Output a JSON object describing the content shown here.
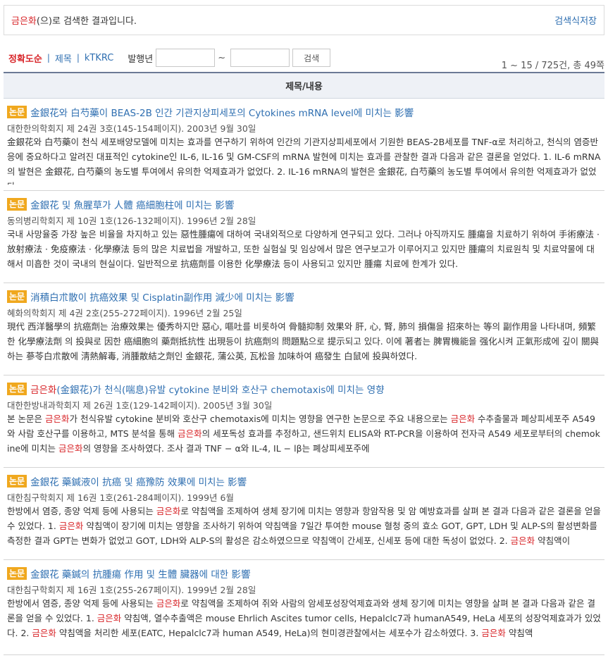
{
  "banner": {
    "keyword": "금은화",
    "message_suffix": "(으)로 검색한 결과입니다.",
    "save_label": "검색식저장"
  },
  "filters": {
    "sort_options": [
      "정확도순",
      "제목",
      "kTKRC"
    ],
    "active_sort": "정확도순",
    "year_label": "발행년",
    "year_from": "",
    "year_to": "",
    "tilde": "~",
    "search_button": "검색"
  },
  "result_count": "1 ~ 15 / 725건, 총 49쪽",
  "table_header": "제목/내용",
  "badge_label": "논문",
  "results": [
    {
      "title": "金銀花와 白芍藥이 BEAS-2B 인간 기관지상피세포의 Cytokines mRNA level에 미치는 影響",
      "source": "대한한의학회지 제 24권 3호(145-154페이지). 2003년 9월 30일",
      "abstract": "金銀花와 白芍藥이 천식 세포배양모델에 미치는 효과를 연구하기 위하여 인간의 기관지상피세포에서 기원한 BEAS-2B세포를 TNF-α로 처리하고, 천식의 염증반응에 중요하다고 알려진 대표적인 cytokine인 IL-6, IL-16 및 GM-CSF의 mRNA 발현에 미치는 효과를 관찰한 결과 다음과 같은 결론을 얻었다. 1. IL-6 mRNA의 발현은 金銀花, 白芍藥의 농도별 투여에서 유의한 억제효과가 없었다. 2. IL-16 mRNA의 발현은 金銀花, 白芍藥의 농도별 투여에서 유의한 억제효과가 없었다."
    },
    {
      "title": "金銀花 및 魚腥草가 人體 癌細胞柱에 미치는 影響",
      "source": "동의병리학회지 제 10권 1호(126-132페이지). 1996년 2월 28일",
      "abstract": "국내 사망율중 가장 높은 비율을 차지하고 있는 惡性腫瘍에 대하여 국내외적으로 다양하게 연구되고 있다. 그러나 아직까지도 腫瘍을 치료하기 위하여 手術療法 · 放射療法 · 免疫療法 · 化學療法 등의 많은 치료법을 개발하고, 또한 실험실 및 임상에서 많은 연구보고가 이루어지고 있지만 腫瘍의 치료원칙 및 치료약물에 대해서 미흡한 것이 국내의 현실이다. 일반적으로 抗癌劑를 이용한 化學療法 등이 사용되고 있지만 腫瘍 치료에 한계가 있다."
    },
    {
      "title": "消積白朮散이 抗癌效果 및 Cisplatin副作用 減少에 미치는 影響",
      "source": "혜화의학회지 제 4권 2호(255-272페이지). 1996년 2월 25일",
      "abstract": "現代 西洋醫學의 抗癌劑는 治療效果는 優秀하지만 惡心, 嘔吐를 비롯하여 骨髓抑制 效果와 肝, 心, 腎, 肺의 損傷을 招來하는 等의 副作用을 나타내며, 頻繁한 化學療法劑 의 投與로 因한 癌細胞의 藥劑抵抗性 出現등이 抗癌劑의 問題點으로 提示되고 있다. 이에 著者는 脾胃機能을 强化시켜 正氣形成에 깊이 關與하는 蔘苓白朮散에 淸熱解毒, 消腫散結之劑인 金銀花, 蒲公英, 瓦松을 加味하여 癌發生 白鼠에 投與하였다."
    },
    {
      "title_parts": [
        {
          "text": "금은화",
          "hl": true
        },
        {
          "text": "(金銀花)가 천식(喘息)유발 cytokine 분비와 호산구 chemotaxis에 미치는 영향",
          "hl": false
        }
      ],
      "source": "대한한방내과학회지 제 26권 1호(129-142페이지). 2005년 3월 30일",
      "abstract_parts": [
        {
          "text": "본 논문은 ",
          "hl": false
        },
        {
          "text": "금은화",
          "hl": true
        },
        {
          "text": "가 천식유발 cytokine 분비와 호산구 chemotaxis에 미치는 영향을 연구한 논문으로 주요 내용으로는 ",
          "hl": false
        },
        {
          "text": "금은화",
          "hl": true
        },
        {
          "text": " 수추출물과 폐상피세포주 A549와 사람 호산구를 이용하고, MTS 분석을 통해 ",
          "hl": false
        },
        {
          "text": "금은화",
          "hl": true
        },
        {
          "text": "의 세포독성 효과를 추정하고, 샌드위치 ELISA와 RT-PCR을 이용하여 전자극 A549 세포로부터의 chemokine에 미치는 ",
          "hl": false
        },
        {
          "text": "금은화",
          "hl": true
        },
        {
          "text": "의 영향을 조사하였다. 조사 결과 TNF − α와 IL-4, IL − lβ는 폐상피세포주에",
          "hl": false
        }
      ]
    },
    {
      "title": "金銀花 藥鍼液이 抗癌 및 癌豫防 效果에 미치는 影響",
      "source": "대한침구학회지 제 16권 1호(261-284페이지). 1999년 6월",
      "abstract_parts": [
        {
          "text": "한방에서 염증, 종양 억제 등에 사용되는 ",
          "hl": false
        },
        {
          "text": "금은화",
          "hl": true
        },
        {
          "text": "로 약침액을 조제하여 생체 장기에 미치는 영향과 항암작용 및 암 예방효과를 살펴 본 결과 다음과 같은 결론을 얻을 수 있었다. 1. ",
          "hl": false
        },
        {
          "text": "금은화",
          "hl": true
        },
        {
          "text": " 약침액이 장기에 미치는 영향을 조사하기 위하여 약침액을 7일간 투여한 mouse 혈청 중의 효소 GOT, GPT, LDH 및 ALP-S의 활성변화를 측정한 결과 GPT는 변화가 없었고 GOT, LDH와 ALP-S의 활성은 감소하였으므로 약침액이 간세포, 신세포 등에 대한 독성이 없었다. 2. ",
          "hl": false
        },
        {
          "text": "금은화",
          "hl": true
        },
        {
          "text": " 약침액이",
          "hl": false
        }
      ]
    },
    {
      "title": "金銀花 藥鍼의 抗腫瘍 作用 및 生體 臟器에 대한 影響",
      "source": "대한침구학회지 제 16권 1호(255-267페이지). 1999년 2월 28일",
      "abstract_parts": [
        {
          "text": "한방에서 염증, 종양 억제 등에 사용되는 ",
          "hl": false
        },
        {
          "text": "금은화",
          "hl": true
        },
        {
          "text": "로 약침액을 조제하여 쥐와 사람의 암세포성장억제효과와 생체 장기에 미치는 영향을 살펴 본 결과 다음과 같은 결론을 얻을 수 있었다. 1. ",
          "hl": false
        },
        {
          "text": "금은화",
          "hl": true
        },
        {
          "text": " 약침액, 열수추출액은 mouse Ehrlich Ascites tumor cells, Hepalclc7과 humanA549, HeLa 세포의 성장억제효과가 있었다. 2. ",
          "hl": false
        },
        {
          "text": "금은화",
          "hl": true
        },
        {
          "text": " 약침액을 처리한 세포(EATC, Hepalclc7과 human A549, HeLa)의 현미경관찰에서는 세포수가 감소하였다. 3. ",
          "hl": false
        },
        {
          "text": "금은화",
          "hl": true
        },
        {
          "text": " 약침액",
          "hl": false
        }
      ]
    }
  ]
}
